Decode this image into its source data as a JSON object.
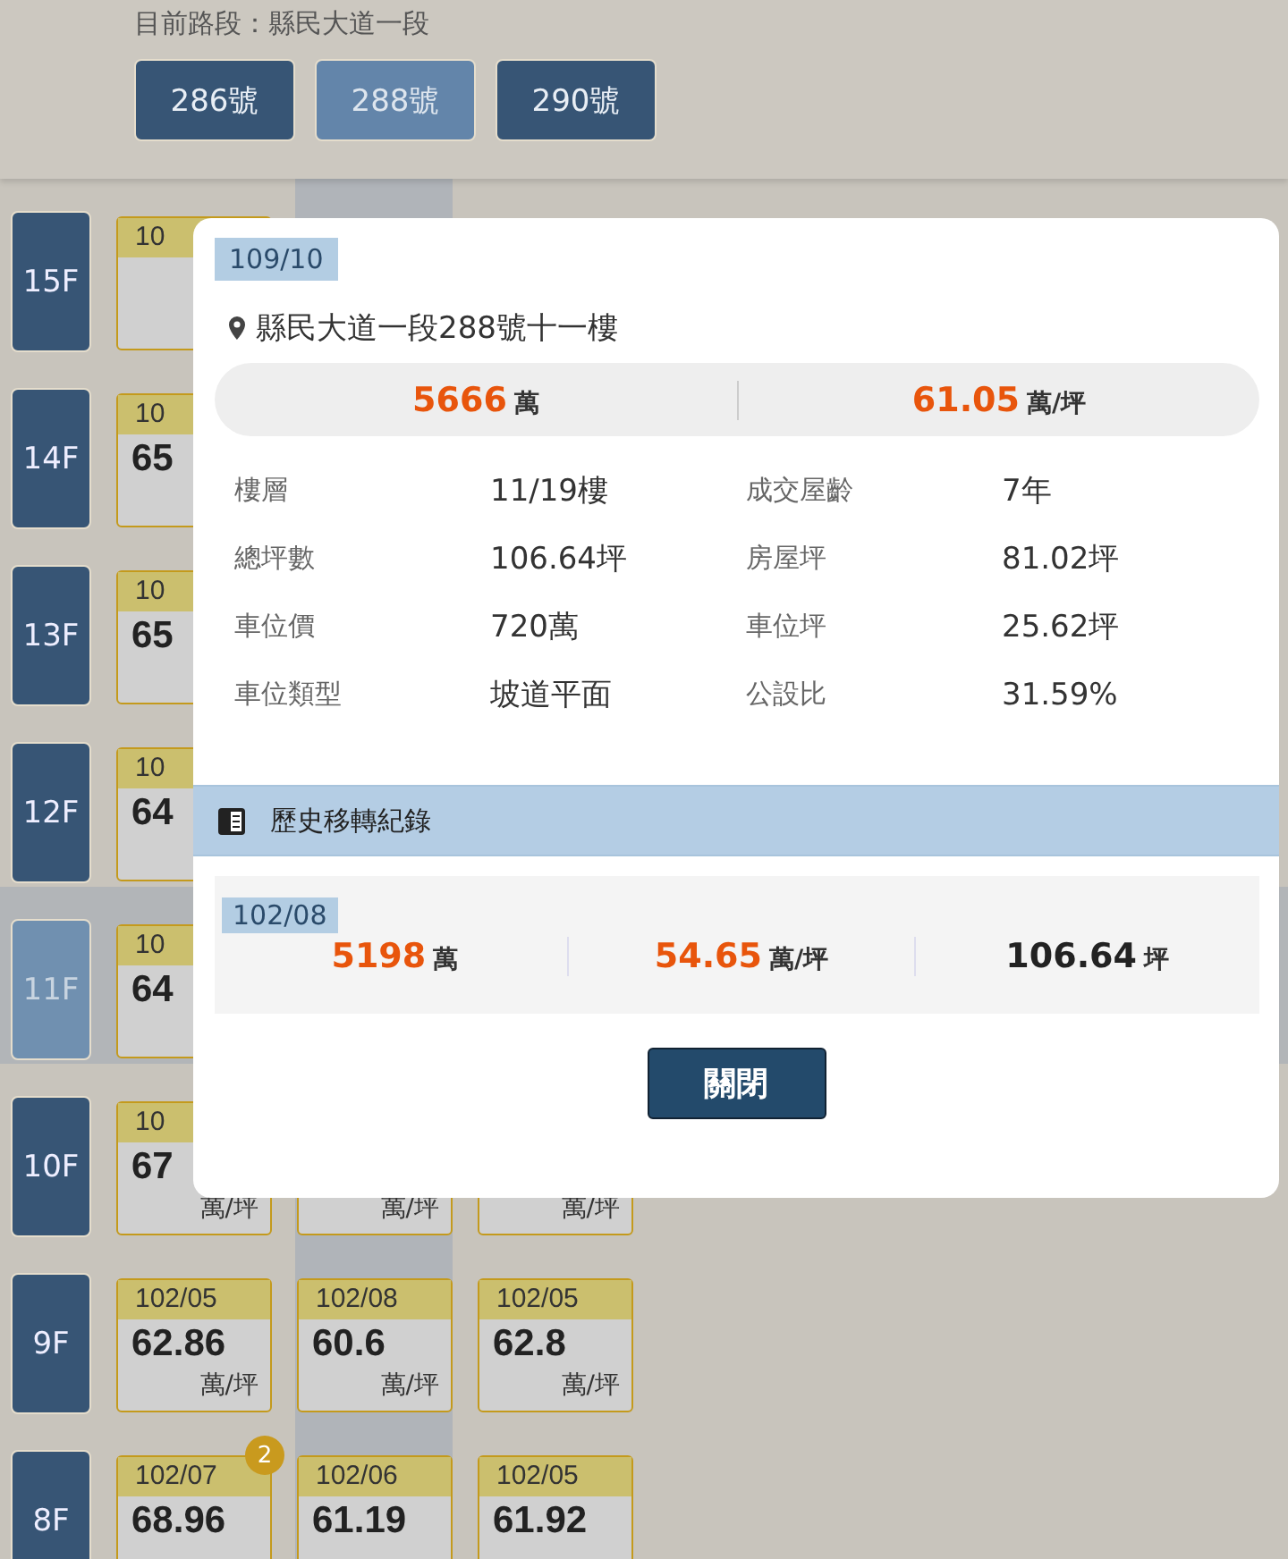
{
  "route_label": "目前路段：縣民大道一段",
  "buildings": [
    {
      "label": "286號",
      "selected": false
    },
    {
      "label": "288號",
      "selected": true
    },
    {
      "label": "290號",
      "selected": false
    }
  ],
  "floors": [
    {
      "label": "15F",
      "selected": false,
      "cards": [
        {
          "date": "10"
        }
      ]
    },
    {
      "label": "14F",
      "selected": false,
      "cards": [
        {
          "date": "10",
          "price": "65"
        }
      ]
    },
    {
      "label": "13F",
      "selected": false,
      "cards": [
        {
          "date": "10",
          "price": "65"
        }
      ]
    },
    {
      "label": "12F",
      "selected": false,
      "cards": [
        {
          "date": "10",
          "price": "64"
        }
      ]
    },
    {
      "label": "11F",
      "selected": true,
      "cards": [
        {
          "date": "10",
          "price": "64"
        }
      ]
    },
    {
      "label": "10F",
      "selected": false,
      "cards": [
        {
          "date": "10",
          "price": "67",
          "unit": "萬/坪"
        },
        {
          "unit": "萬/坪"
        },
        {
          "unit": "萬/坪"
        }
      ]
    },
    {
      "label": "9F",
      "selected": false,
      "cards": [
        {
          "date": "102/05",
          "price": "62.86",
          "unit": "萬/坪"
        },
        {
          "date": "102/08",
          "price": "60.6",
          "unit": "萬/坪"
        },
        {
          "date": "102/05",
          "price": "62.8",
          "unit": "萬/坪"
        }
      ]
    },
    {
      "label": "8F",
      "selected": false,
      "cards": [
        {
          "date": "102/07",
          "price": "68.96",
          "badge": "2"
        },
        {
          "date": "102/06",
          "price": "61.19"
        },
        {
          "date": "102/05",
          "price": "61.92"
        }
      ]
    }
  ],
  "modal": {
    "date": "109/10",
    "address": "縣民大道一段288號十一樓",
    "summary": [
      {
        "kind": "price",
        "value": "5666",
        "unit": "萬"
      },
      {
        "kind": "price",
        "value": "61.05",
        "unit": "萬/坪"
      }
    ],
    "details": [
      {
        "label": "樓層",
        "value": "11/19樓"
      },
      {
        "label": "成交屋齡",
        "value": "7年"
      },
      {
        "label": "總坪數",
        "value": "106.64坪"
      },
      {
        "label": "房屋坪",
        "value": "81.02坪"
      },
      {
        "label": "車位價",
        "value": "720萬"
      },
      {
        "label": "車位坪",
        "value": "25.62坪"
      },
      {
        "label": "車位類型",
        "value": "坡道平面"
      },
      {
        "label": "公設比",
        "value": "31.59%"
      }
    ],
    "history_title": "歷史移轉紀錄",
    "history": [
      {
        "date": "102/08",
        "stats": [
          {
            "kind": "price",
            "value": "5198",
            "unit": "萬"
          },
          {
            "kind": "price",
            "value": "54.65",
            "unit": "萬/坪"
          },
          {
            "kind": "area",
            "value": "106.64",
            "unit": "坪"
          }
        ]
      }
    ],
    "close_label": "關閉"
  }
}
